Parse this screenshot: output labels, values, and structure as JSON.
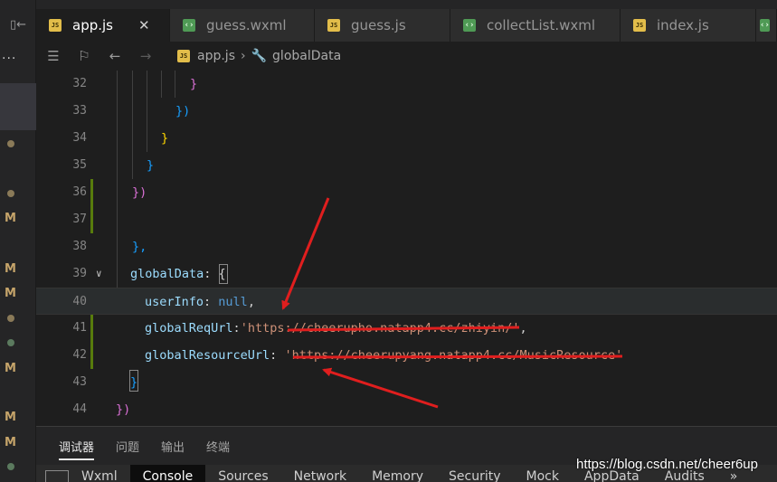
{
  "tabs": [
    {
      "label": "app.js",
      "kind": "js",
      "active": true
    },
    {
      "label": "guess.wxml",
      "kind": "wxml"
    },
    {
      "label": "guess.js",
      "kind": "js"
    },
    {
      "label": "collectList.wxml",
      "kind": "wxml"
    },
    {
      "label": "index.js",
      "kind": "js"
    }
  ],
  "breadcrumb": {
    "file": "app.js",
    "symbol": "globalData"
  },
  "activity_markers": [
    "M",
    "M",
    "M",
    "M",
    "M",
    "M"
  ],
  "code_lines": [
    {
      "number": "32"
    },
    {
      "number": "33"
    },
    {
      "number": "34"
    },
    {
      "number": "35"
    },
    {
      "number": "36"
    },
    {
      "number": "37"
    },
    {
      "number": "38"
    },
    {
      "number": "39"
    },
    {
      "number": "40"
    },
    {
      "number": "41"
    },
    {
      "number": "42"
    },
    {
      "number": "43"
    },
    {
      "number": "44"
    }
  ],
  "code": {
    "l32": "}",
    "l33": "})",
    "l34": "}",
    "l35": "}",
    "l36": "})",
    "l38": "},",
    "l39_key": "globalData",
    "l39_rest": ": {",
    "l40_key": "userInfo",
    "l40_colon": ": ",
    "l40_val": "null",
    "l40_comma": ",",
    "l41_key": "globalReqUrl",
    "l41_colon": ":",
    "l41_val": "'https://cheerupho.natapp4.cc/zhiyin/'",
    "l41_comma": ",",
    "l42_key": "globalResourceUrl",
    "l42_colon": ": ",
    "l42_val": "'https://cheerupyang.natapp4.cc/MusicResource'",
    "l43": "}",
    "l44": "})"
  },
  "panel_tabs": [
    "调试器",
    "问题",
    "输出",
    "终端"
  ],
  "devtools_tabs": [
    "Wxml",
    "Console",
    "Sources",
    "Network",
    "Memory",
    "Security",
    "Mock",
    "AppData",
    "Audits"
  ],
  "devtools_more": "»",
  "watermark": "https://blog.csdn.net/cheer6up",
  "colors": {
    "annotation": "#e01e1e",
    "js_badge": "#e2bd4a",
    "wxml_badge": "#4f9a55"
  }
}
